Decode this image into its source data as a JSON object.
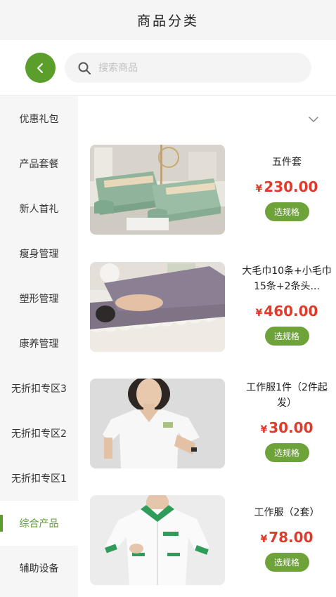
{
  "header": {
    "title": "商品分类"
  },
  "search": {
    "placeholder": "搜索商品"
  },
  "sidebar": {
    "items": [
      {
        "label": "优惠礼包"
      },
      {
        "label": "产品套餐"
      },
      {
        "label": "新人首礼"
      },
      {
        "label": "瘦身管理"
      },
      {
        "label": "塑形管理"
      },
      {
        "label": "康养管理"
      },
      {
        "label": "无折扣专区3"
      },
      {
        "label": "无折扣专区2"
      },
      {
        "label": "无折扣专区1"
      },
      {
        "label": "综合产品"
      },
      {
        "label": "辅助设备"
      }
    ],
    "active_index": 9
  },
  "products": [
    {
      "name": "五件套",
      "currency": "¥",
      "price": "230.00",
      "button": "选规格"
    },
    {
      "name": "大毛巾10条+小毛巾15条+2条头...",
      "currency": "¥",
      "price": "460.00",
      "button": "选规格"
    },
    {
      "name": "工作服1件（2件起发）",
      "currency": "¥",
      "price": "30.00",
      "button": "选规格"
    },
    {
      "name": "工作服（2套）",
      "currency": "¥",
      "price": "78.00",
      "button": "选规格"
    }
  ],
  "colors": {
    "accent": "#5c9e2c",
    "price": "#e03a2b",
    "button": "#6ea33a"
  }
}
